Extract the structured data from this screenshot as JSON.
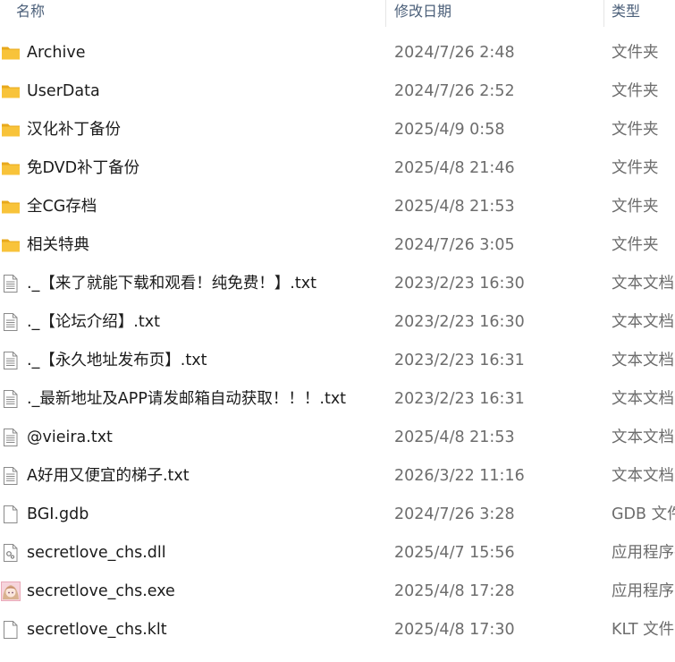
{
  "header": {
    "name_label": "名称",
    "date_label": "修改日期",
    "type_label": "类型"
  },
  "colors": {
    "folder": "#f8c33a",
    "folder_dark": "#e8a91c",
    "header_text": "#4c607a"
  },
  "files": [
    {
      "name": "Archive",
      "date": "2024/7/26 2:48",
      "type": "文件夹",
      "icon": "folder-icon"
    },
    {
      "name": "UserData",
      "date": "2024/7/26 2:52",
      "type": "文件夹",
      "icon": "folder-icon"
    },
    {
      "name": "汉化补丁备份",
      "date": "2025/4/9 0:58",
      "type": "文件夹",
      "icon": "folder-icon"
    },
    {
      "name": "免DVD补丁备份",
      "date": "2025/4/8 21:46",
      "type": "文件夹",
      "icon": "folder-icon"
    },
    {
      "name": "全CG存档",
      "date": "2025/4/8 21:53",
      "type": "文件夹",
      "icon": "folder-icon"
    },
    {
      "name": "相关特典",
      "date": "2024/7/26 3:05",
      "type": "文件夹",
      "icon": "folder-icon"
    },
    {
      "name": "._【来了就能下载和观看！纯免费！】.txt",
      "date": "2023/2/23 16:30",
      "type": "文本文档",
      "icon": "text-file-icon"
    },
    {
      "name": "._【论坛介绍】.txt",
      "date": "2023/2/23 16:30",
      "type": "文本文档",
      "icon": "text-file-icon"
    },
    {
      "name": "._【永久地址发布页】.txt",
      "date": "2023/2/23 16:31",
      "type": "文本文档",
      "icon": "text-file-icon"
    },
    {
      "name": "._最新地址及APP请发邮箱自动获取！！！.txt",
      "date": "2023/2/23 16:31",
      "type": "文本文档",
      "icon": "text-file-icon"
    },
    {
      "name": "@vieira.txt",
      "date": "2025/4/8 21:53",
      "type": "文本文档",
      "icon": "text-file-icon"
    },
    {
      "name": "A好用又便宜的梯子.txt",
      "date": "2026/3/22 11:16",
      "type": "文本文档",
      "icon": "text-file-icon"
    },
    {
      "name": "BGI.gdb",
      "date": "2024/7/26 3:28",
      "type": "GDB 文件",
      "icon": "blank-file-icon"
    },
    {
      "name": "secretlove_chs.dll",
      "date": "2025/4/7 15:56",
      "type": "应用程序扩展",
      "icon": "dll-file-icon"
    },
    {
      "name": "secretlove_chs.exe",
      "date": "2025/4/8 17:28",
      "type": "应用程序",
      "icon": "exe-app-icon"
    },
    {
      "name": "secretlove_chs.klt",
      "date": "2025/4/8 17:30",
      "type": "KLT 文件",
      "icon": "blank-file-icon"
    }
  ]
}
